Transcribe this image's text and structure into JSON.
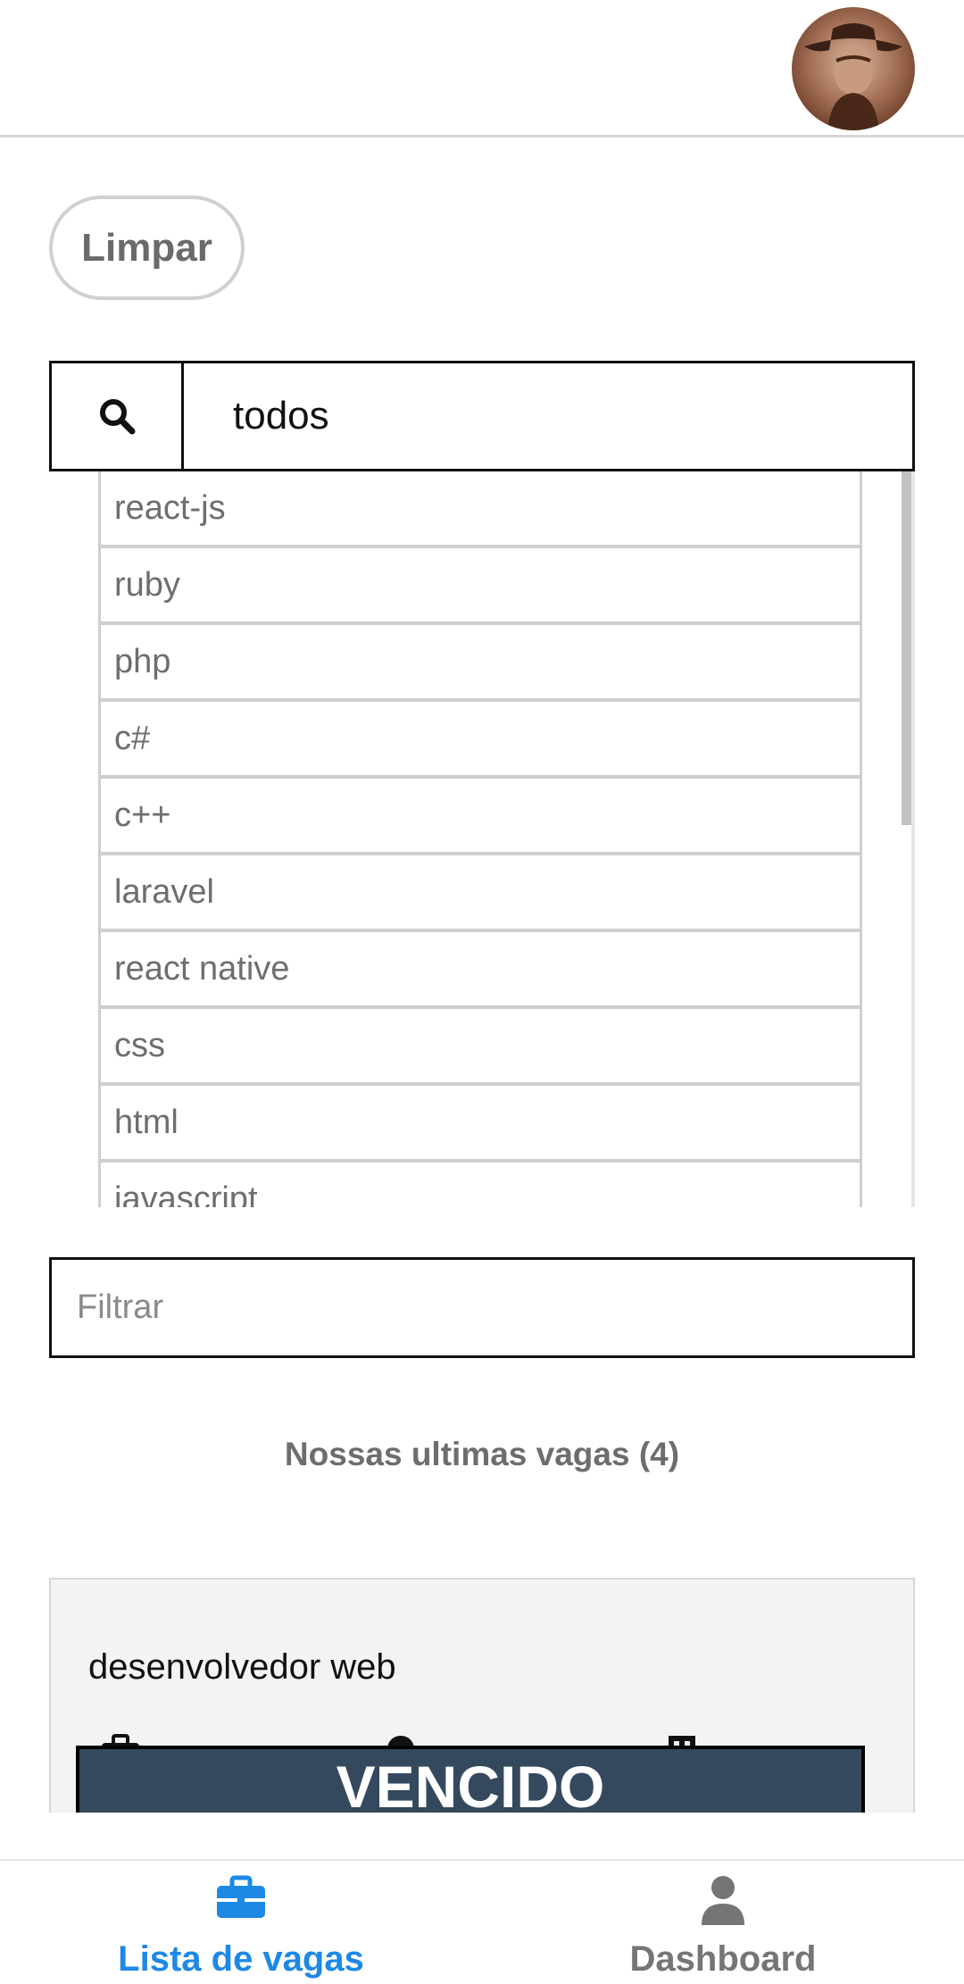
{
  "header": {
    "avatar_icon": "user-avatar-photo"
  },
  "actions": {
    "clear_label": "Limpar"
  },
  "search": {
    "icon": "search-icon",
    "selected_value": "todos"
  },
  "dropdown": {
    "items": [
      "react-js",
      "ruby",
      "php",
      "c#",
      "c++",
      "laravel",
      "react native",
      "css",
      "html",
      "javascript"
    ]
  },
  "filter": {
    "placeholder": "Filtrar",
    "value": ""
  },
  "jobs": {
    "section_title": "Nossas ultimas vagas (4)",
    "cards": [
      {
        "title": "desenvolvedor web",
        "status": "VENCIDO",
        "meta_icons": [
          "briefcase-icon",
          "location-pin-icon",
          "building-icon"
        ]
      }
    ]
  },
  "nav": {
    "items": [
      {
        "label": "Lista de vagas",
        "icon": "briefcase-icon",
        "active": true
      },
      {
        "label": "Dashboard",
        "icon": "person-icon",
        "active": false
      }
    ]
  },
  "colors": {
    "accent": "#1e88e5",
    "nav_inactive": "#757575",
    "badge_bg": "#34495e",
    "card_bg": "#f3f3f3"
  }
}
